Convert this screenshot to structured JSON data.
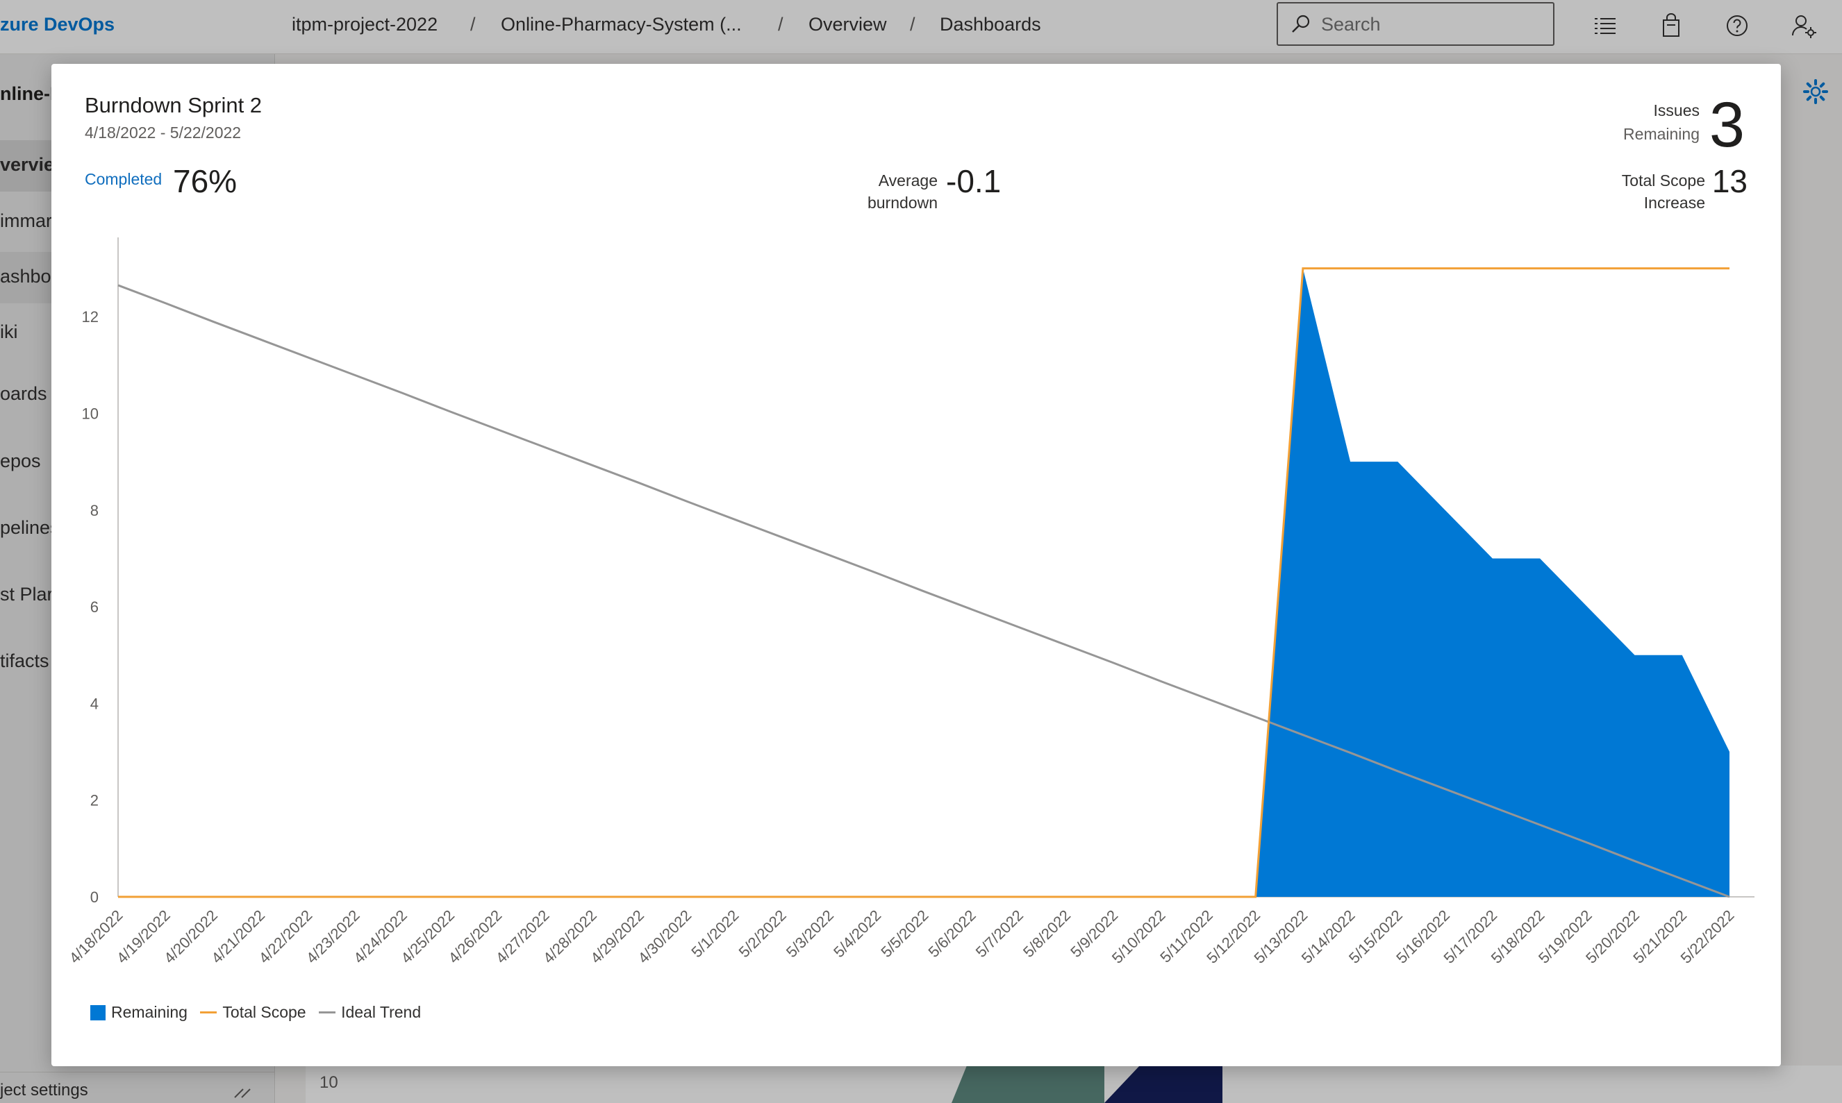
{
  "app": {
    "brand": "zure DevOps",
    "breadcrumbs": [
      "itpm-project-2022",
      "Online-Pharmacy-System (...",
      "Overview",
      "Dashboards"
    ],
    "search_placeholder": "Search",
    "project_name": "nline-I",
    "sidebar": [
      {
        "label": "verview",
        "state": "active"
      },
      {
        "label": "immar",
        "state": "normal"
      },
      {
        "label": "ashboa",
        "state": "selected"
      },
      {
        "label": "iki",
        "state": "normal"
      },
      {
        "label": "oards",
        "state": "normal"
      },
      {
        "label": "epos",
        "state": "normal"
      },
      {
        "label": "pelines",
        "state": "normal"
      },
      {
        "label": "st Plar",
        "state": "normal"
      },
      {
        "label": "tifacts",
        "state": "normal"
      }
    ],
    "sidebar_bottom": "ject settings",
    "background_tick": "10"
  },
  "widget": {
    "title": "Burndown Sprint 2",
    "dates": "4/18/2022 - 5/22/2022",
    "completed_label": "Completed",
    "completed_value": "76%",
    "avg_label_line1": "Average",
    "avg_label_line2": "burndown",
    "avg_value": "-0.1",
    "issues_label_line1": "Issues",
    "issues_label_line2": "Remaining",
    "issues_value": "3",
    "scope_label_line1": "Total Scope",
    "scope_label_line2": "Increase",
    "scope_value": "13"
  },
  "colors": {
    "remaining": "#0078d4",
    "total_scope": "#f2a036",
    "ideal_trend": "#969696",
    "axis": "#c8c6c4"
  },
  "chart_data": {
    "type": "area",
    "x": [
      "4/18/2022",
      "4/19/2022",
      "4/20/2022",
      "4/21/2022",
      "4/22/2022",
      "4/23/2022",
      "4/24/2022",
      "4/25/2022",
      "4/26/2022",
      "4/27/2022",
      "4/28/2022",
      "4/29/2022",
      "4/30/2022",
      "5/1/2022",
      "5/2/2022",
      "5/3/2022",
      "5/4/2022",
      "5/5/2022",
      "5/6/2022",
      "5/7/2022",
      "5/8/2022",
      "5/9/2022",
      "5/10/2022",
      "5/11/2022",
      "5/12/2022",
      "5/13/2022",
      "5/14/2022",
      "5/15/2022",
      "5/16/2022",
      "5/17/2022",
      "5/18/2022",
      "5/19/2022",
      "5/20/2022",
      "5/21/2022",
      "5/22/2022"
    ],
    "series": [
      {
        "name": "Remaining",
        "kind": "area",
        "values": [
          0,
          0,
          0,
          0,
          0,
          0,
          0,
          0,
          0,
          0,
          0,
          0,
          0,
          0,
          0,
          0,
          0,
          0,
          0,
          0,
          0,
          0,
          0,
          0,
          0,
          13,
          9,
          9,
          8,
          7,
          7,
          6,
          5,
          5,
          3
        ]
      },
      {
        "name": "Total Scope",
        "kind": "line",
        "values": [
          0,
          0,
          0,
          0,
          0,
          0,
          0,
          0,
          0,
          0,
          0,
          0,
          0,
          0,
          0,
          0,
          0,
          0,
          0,
          0,
          0,
          0,
          0,
          0,
          0,
          13,
          13,
          13,
          13,
          13,
          13,
          13,
          13,
          13,
          13
        ]
      },
      {
        "name": "Ideal Trend",
        "kind": "line",
        "values": [
          12.65,
          12.28,
          11.9,
          11.53,
          11.16,
          10.79,
          10.42,
          10.04,
          9.67,
          9.3,
          8.93,
          8.56,
          8.18,
          7.81,
          7.44,
          7.07,
          6.7,
          6.32,
          5.95,
          5.58,
          5.21,
          4.84,
          4.46,
          4.09,
          3.72,
          3.35,
          2.98,
          2.6,
          2.23,
          1.86,
          1.49,
          1.12,
          0.74,
          0.37,
          0
        ]
      }
    ],
    "y_ticks": [
      0,
      2,
      4,
      6,
      8,
      10,
      12
    ],
    "ylim": [
      0,
      13.64
    ],
    "legend": "bottom-left",
    "grid": false
  }
}
